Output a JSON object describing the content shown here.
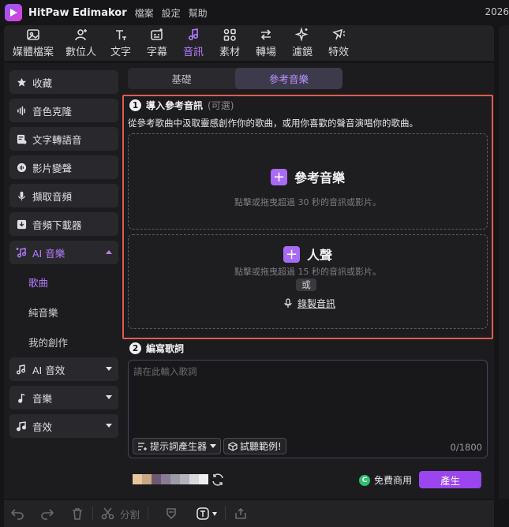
{
  "app": {
    "name": "HitPaw Edimakor",
    "clock": "2026"
  },
  "menu": [
    "檔案",
    "設定",
    "幫助"
  ],
  "toolbar": [
    {
      "label": "媒體檔案",
      "icon": "media-icon"
    },
    {
      "label": "數位人",
      "icon": "avatar-icon"
    },
    {
      "label": "文字",
      "icon": "text-icon"
    },
    {
      "label": "字幕",
      "icon": "subtitle-icon"
    },
    {
      "label": "音訊",
      "icon": "audio-icon"
    },
    {
      "label": "素材",
      "icon": "assets-icon"
    },
    {
      "label": "轉場",
      "icon": "transition-icon"
    },
    {
      "label": "濾鏡",
      "icon": "filter-icon"
    },
    {
      "label": "特效",
      "icon": "effects-icon"
    }
  ],
  "sidebar": {
    "items": [
      {
        "label": "收藏",
        "icon": "star-icon"
      },
      {
        "label": "音色克隆",
        "icon": "waveform-icon"
      },
      {
        "label": "文字轉語音",
        "icon": "text-to-speech-icon"
      },
      {
        "label": "影片變聲",
        "icon": "voice-change-icon"
      },
      {
        "label": "擷取音頻",
        "icon": "microphone-icon"
      },
      {
        "label": "音頻下載器",
        "icon": "download-icon"
      },
      {
        "label": "AI 音樂",
        "icon": "ai-music-icon"
      },
      {
        "label": "AI 音效",
        "icon": "ai-sfx-icon"
      },
      {
        "label": "音樂",
        "icon": "music-note-icon"
      },
      {
        "label": "音效",
        "icon": "sound-effect-icon"
      }
    ],
    "sub_items": [
      "歌曲",
      "純音樂",
      "我的創作"
    ]
  },
  "tabs": [
    "基礎",
    "參考音樂"
  ],
  "step1": {
    "number": "1",
    "title": "導入參考音訊",
    "optional": "(可選)",
    "description": "從參考歌曲中汲取靈感創作你的歌曲，或用你喜歡的聲音演唱你的歌曲。"
  },
  "reference": {
    "title": "參考音樂",
    "hint": "點擊或拖曳超過 30 秒的音訊或影片。"
  },
  "vocal": {
    "title": "人聲",
    "hint": "點擊或拖曳超過 15 秒的音訊或影片。",
    "or": "或",
    "record": "錄製音訊"
  },
  "step2": {
    "number": "2",
    "title": "編寫歌詞"
  },
  "lyrics": {
    "placeholder": "請在此輸入歌詞",
    "prompt_button": "提示詞產生器",
    "sample_button": "試聽範例!",
    "counter": "0/1800"
  },
  "footer": {
    "free_label": "免費商用",
    "generate_label": "產生"
  },
  "bottom_toolbar": {
    "split_label": "分割"
  },
  "colors": {
    "accent": "#b57cff",
    "button": "#9b45ee",
    "highlight_border": "#e25a4e"
  }
}
